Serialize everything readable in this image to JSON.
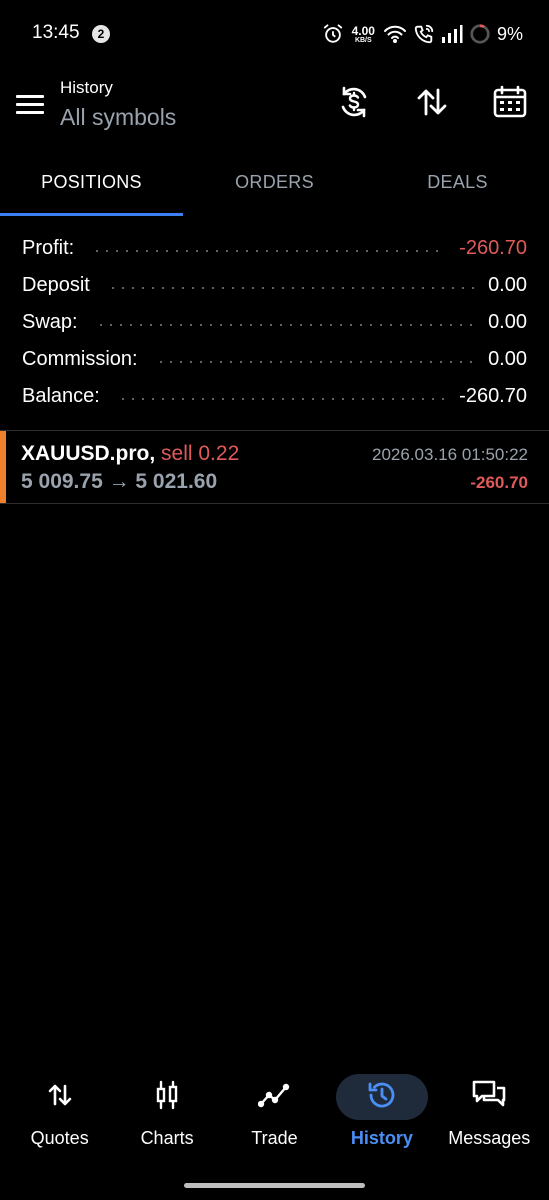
{
  "status_bar": {
    "time": "13:45",
    "notification_count": "2",
    "net_speed_value": "4.00",
    "net_speed_unit": "KB/S",
    "battery": "9%"
  },
  "header": {
    "title": "History",
    "subtitle": "All symbols",
    "icons": [
      "currency-refresh-icon",
      "sort-arrows-icon",
      "calendar-icon"
    ]
  },
  "tabs": [
    {
      "label": "POSITIONS",
      "active": true
    },
    {
      "label": "ORDERS",
      "active": false
    },
    {
      "label": "DEALS",
      "active": false
    }
  ],
  "summary": {
    "profit_label": "Profit:",
    "profit_value": "-260.70",
    "deposit_label": "Deposit",
    "deposit_value": "0.00",
    "swap_label": "Swap:",
    "swap_value": "0.00",
    "commission_label": "Commission:",
    "commission_value": "0.00",
    "balance_label": "Balance:",
    "balance_value": "-260.70"
  },
  "positions": [
    {
      "symbol": "XAUUSD.pro,",
      "side": "sell 0.22",
      "datetime": "2026.03.16 01:50:22",
      "prices": "5 009.75 → 5 021.60",
      "profit": "-260.70"
    }
  ],
  "bottom_nav": [
    {
      "label": "Quotes",
      "icon": "quotes-arrows-icon",
      "active": false
    },
    {
      "label": "Charts",
      "icon": "candlestick-icon",
      "active": false
    },
    {
      "label": "Trade",
      "icon": "trend-line-icon",
      "active": false
    },
    {
      "label": "History",
      "icon": "history-clock-icon",
      "active": true
    },
    {
      "label": "Messages",
      "icon": "messages-icon",
      "active": false
    }
  ],
  "colors": {
    "background": "#000000",
    "accent_blue": "#3d7ff2",
    "negative_red": "#e05a5a",
    "position_accent": "#f0802a",
    "muted_text": "#9aa3ad"
  }
}
